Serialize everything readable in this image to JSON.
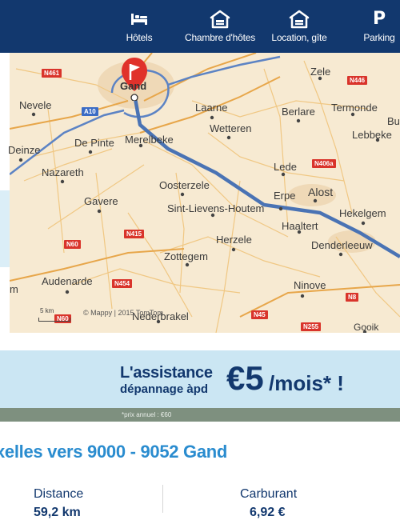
{
  "nav": {
    "items": [
      {
        "label": "Hôtels",
        "icon": "bed-icon"
      },
      {
        "label": "Chambre d'hôtes",
        "icon": "house-icon"
      },
      {
        "label": "Location, gîte",
        "icon": "house-icon"
      },
      {
        "label": "Parking",
        "icon": "parking-icon",
        "glyph": "P"
      }
    ]
  },
  "map": {
    "places": [
      "Gand",
      "Zele",
      "Nevele",
      "Laarne",
      "Berlare",
      "Termonde",
      "Lebbeke",
      "Bu",
      "Deinze",
      "De Pinte",
      "Merelbeke",
      "Wetteren",
      "Nazareth",
      "Lede",
      "Oosterzele",
      "Erpe",
      "Alost",
      "Gavere",
      "Sint-Lievens-Houtem",
      "Haaltert",
      "Hekelgem",
      "Herzele",
      "Denderleeuw",
      "Zottegem",
      "Audenarde",
      "Ninove",
      "Gooik",
      "Nederbrakel",
      "m"
    ],
    "roads": [
      "N461",
      "A10",
      "N446",
      "N406a",
      "N60",
      "N415",
      "N454",
      "N60",
      "N45",
      "N8",
      "N255"
    ],
    "scale": "5 km",
    "credit": "© Mappy | 2015 TomTom"
  },
  "ad": {
    "line1": "L'assistance",
    "line2": "dépannage àpd",
    "price": "€5",
    "suffix": "/mois* !",
    "note": "*prix annuel : €60"
  },
  "route": {
    "title": "xelles vers 9000 - 9052 Gand"
  },
  "stats": {
    "distance_label": "Distance",
    "distance_value": "59,2 km",
    "fuel_label": "Carburant",
    "fuel_value": "6,92 €"
  },
  "colors": {
    "nav_bg": "#12386e",
    "route_line": "#4a73b4",
    "pin": "#e0322b",
    "title": "#2a8ccf",
    "ad_bg": "#cbe6f3"
  }
}
